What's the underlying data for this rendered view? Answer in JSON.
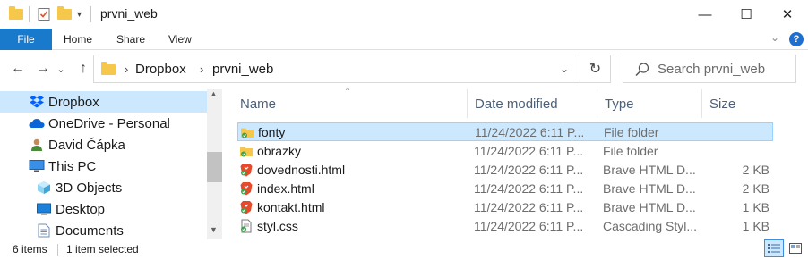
{
  "window": {
    "title": "prvni_web",
    "minimize_glyph": "—",
    "maximize_glyph": "☐",
    "close_glyph": "✕"
  },
  "ribbon": {
    "tabs": [
      "File",
      "Home",
      "Share",
      "View"
    ],
    "expand_glyph": "⌄",
    "help_glyph": "?"
  },
  "address": {
    "back_glyph": "←",
    "forward_glyph": "→",
    "recent_glyph": "⌄",
    "up_glyph": "↑",
    "breadcrumb": [
      "Dropbox",
      "prvni_web"
    ],
    "separator": "›",
    "dropdown_glyph": "⌄",
    "refresh_glyph": "↻"
  },
  "search": {
    "placeholder": "Search prvni_web"
  },
  "nav": {
    "items": [
      {
        "label": "Dropbox",
        "icon": "dropbox-icon",
        "selected": true
      },
      {
        "label": "OneDrive - Personal",
        "icon": "onedrive-icon"
      },
      {
        "label": "David Čápka",
        "icon": "user-icon"
      },
      {
        "label": "This PC",
        "icon": "pc-icon"
      },
      {
        "label": "3D Objects",
        "icon": "3d-objects-icon"
      },
      {
        "label": "Desktop",
        "icon": "desktop-icon"
      },
      {
        "label": "Documents",
        "icon": "documents-icon"
      }
    ]
  },
  "columns": {
    "name": "Name",
    "date": "Date modified",
    "type": "Type",
    "size": "Size"
  },
  "files": [
    {
      "name": "fonty",
      "date": "11/24/2022 6:11 P...",
      "type": "File folder",
      "size": "",
      "icon": "folder-icon",
      "selected": true
    },
    {
      "name": "obrazky",
      "date": "11/24/2022 6:11 P...",
      "type": "File folder",
      "size": "",
      "icon": "folder-icon"
    },
    {
      "name": "dovednosti.html",
      "date": "11/24/2022 6:11 P...",
      "type": "Brave HTML D...",
      "size": "2 KB",
      "icon": "brave-html-icon"
    },
    {
      "name": "index.html",
      "date": "11/24/2022 6:11 P...",
      "type": "Brave HTML D...",
      "size": "2 KB",
      "icon": "brave-html-icon"
    },
    {
      "name": "kontakt.html",
      "date": "11/24/2022 6:11 P...",
      "type": "Brave HTML D...",
      "size": "1 KB",
      "icon": "brave-html-icon"
    },
    {
      "name": "styl.css",
      "date": "11/24/2022 6:11 P...",
      "type": "Cascading Styl...",
      "size": "1 KB",
      "icon": "css-file-icon"
    }
  ],
  "status": {
    "items": "6 items",
    "selected": "1 item selected"
  },
  "colors": {
    "accent": "#1979ca",
    "selection": "#cce8ff",
    "folder": "#f5c84c",
    "brave": "#e8492b"
  }
}
